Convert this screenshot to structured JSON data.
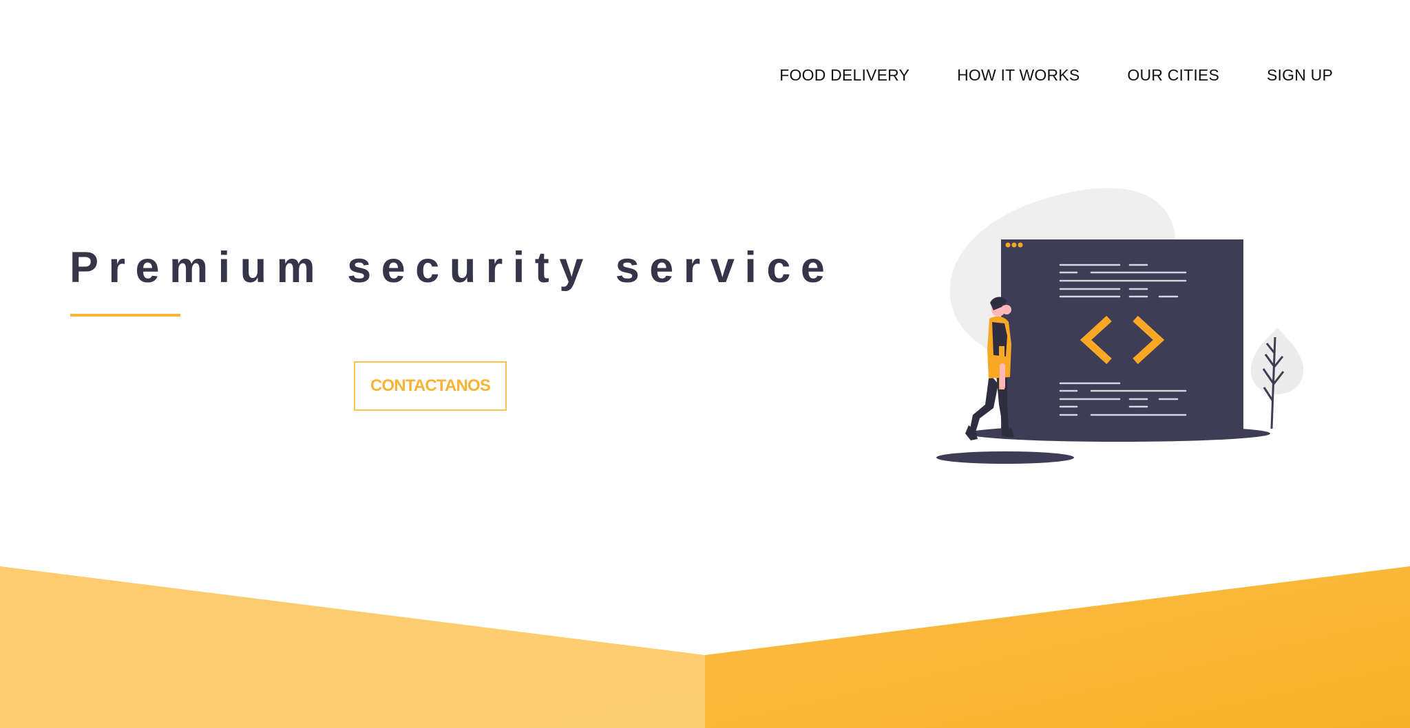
{
  "nav": {
    "items": [
      {
        "label": "FOOD DELIVERY"
      },
      {
        "label": "HOW IT WORKS"
      },
      {
        "label": "OUR CITIES"
      },
      {
        "label": "SIGN UP"
      }
    ]
  },
  "hero": {
    "title": "Premium security service",
    "cta_label": "CONTACTANOS"
  },
  "illustration": {
    "icon": "code-window-person-icon"
  },
  "colors": {
    "accent": "#f9b334",
    "accent_light": "#fccf71",
    "dark": "#363449",
    "text": "#111111",
    "background": "#ffffff"
  }
}
